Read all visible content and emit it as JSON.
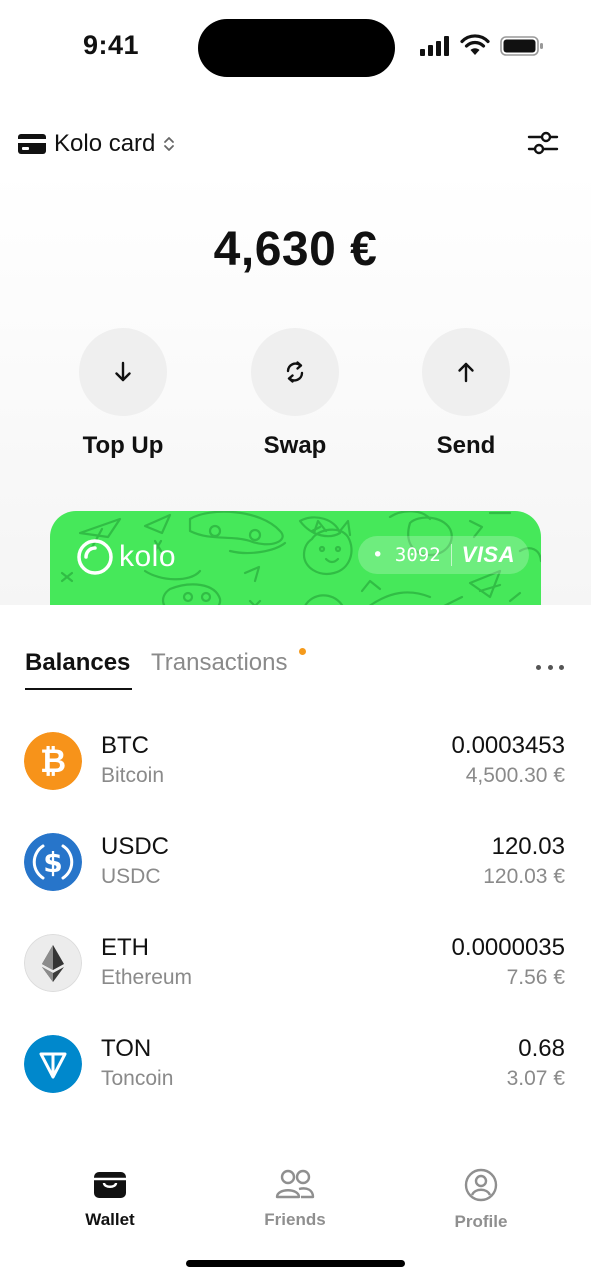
{
  "status_bar": {
    "time": "9:41"
  },
  "header": {
    "card_selector_label": "Kolo card"
  },
  "balance": {
    "total": "4,630 €"
  },
  "actions": [
    {
      "label": "Top Up",
      "icon": "arrow-down-icon"
    },
    {
      "label": "Swap",
      "icon": "swap-icon"
    },
    {
      "label": "Send",
      "icon": "arrow-up-icon"
    }
  ],
  "card": {
    "brand": "kolo",
    "number": "• 3092",
    "network": "VISA",
    "color": "#46e85a"
  },
  "tabs": {
    "balances": "Balances",
    "transactions": "Transactions",
    "transactions_has_notification": true
  },
  "assets": [
    {
      "symbol": "BTC",
      "name": "Bitcoin",
      "amount": "0.0003453",
      "fiat": "4,500.30 €",
      "icon": "bitcoin-icon",
      "color": "#f7931a"
    },
    {
      "symbol": "USDC",
      "name": "USDC",
      "amount": "120.03",
      "fiat": "120.03 €",
      "icon": "usdc-icon",
      "color": "#2775ca"
    },
    {
      "symbol": "ETH",
      "name": "Ethereum",
      "amount": "0.0000035",
      "fiat": "7.56 €",
      "icon": "ethereum-icon",
      "color": "#ececec"
    },
    {
      "symbol": "TON",
      "name": "Toncoin",
      "amount": "0.68",
      "fiat": "3.07 €",
      "icon": "toncoin-icon",
      "color": "#0088cc"
    }
  ],
  "tabbar": {
    "wallet": "Wallet",
    "friends": "Friends",
    "profile": "Profile"
  }
}
